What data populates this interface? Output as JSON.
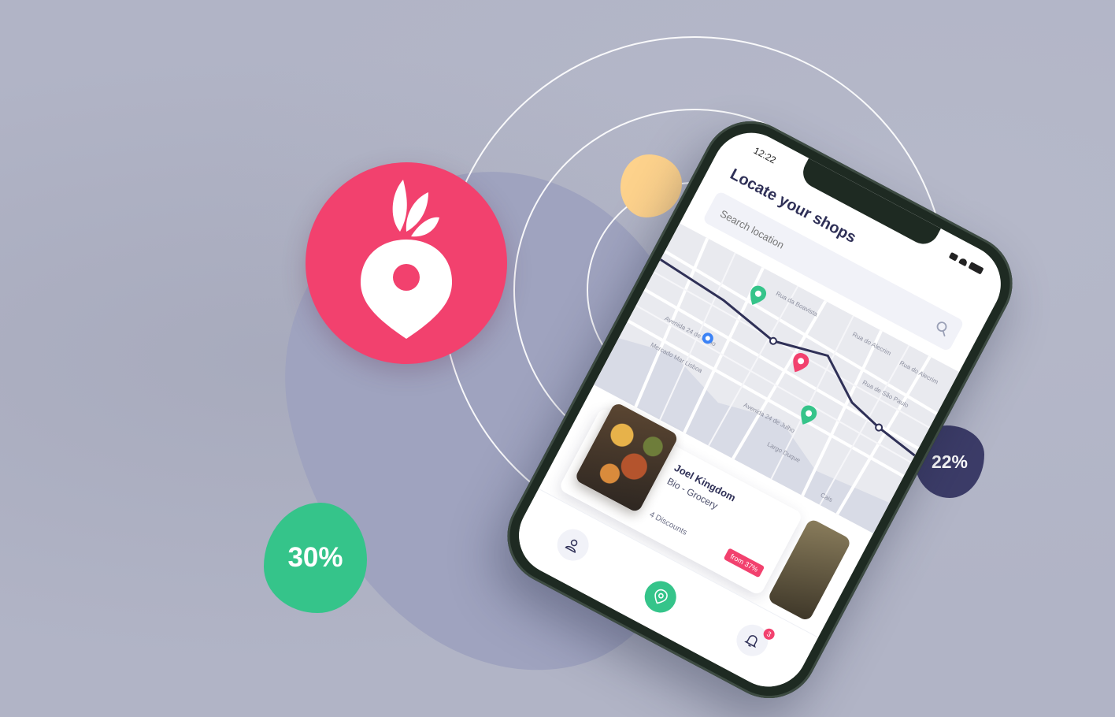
{
  "colors": {
    "background": "#b1b4c6",
    "brand_pink": "#f2416e",
    "green": "#35c48a",
    "navy": "#3c3c68",
    "yellow": "#fdd28c",
    "route": "#2f3057"
  },
  "badges": {
    "left_discount": "30%",
    "right_discount": "22%"
  },
  "logo": {
    "icon": "radish-location-pin-icon"
  },
  "phone": {
    "status_time": "12:22",
    "title": "Locate your shops",
    "search": {
      "placeholder": "Search location",
      "value": ""
    },
    "map": {
      "street_labels": [
        "Rua da Boavista",
        "Rua de São Paulo",
        "Avenida 24 de Julho",
        "Mercado Mar Lisboa",
        "Avenida 24 de Julho",
        "Largo Duque",
        "Rua do Alecrim",
        "Cais",
        "Rua do Alecrim"
      ],
      "pins": [
        "green-pin",
        "pink-pin",
        "green-pin",
        "blue-user-location"
      ]
    },
    "shop_card": {
      "name": "Joel Kingdom",
      "category": "Bio - Grocery",
      "discounts": "4 Discounts",
      "tag": "from 37%"
    },
    "nav": {
      "items": [
        "profile-icon",
        "map-pin-icon",
        "bell-icon"
      ],
      "notification_count": "3"
    }
  }
}
